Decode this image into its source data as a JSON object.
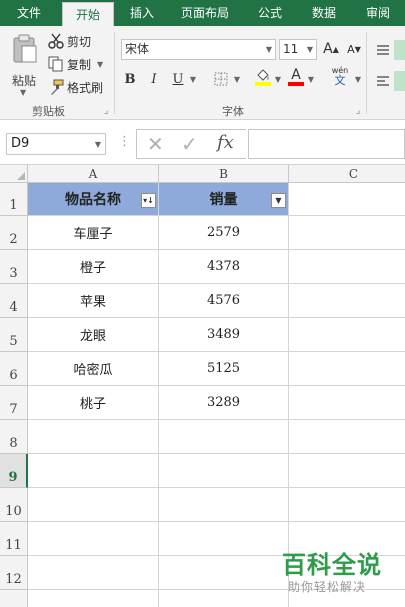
{
  "ribbon_tabs": [
    "文件",
    "开始",
    "插入",
    "页面布局",
    "公式",
    "数据",
    "审阅"
  ],
  "active_tab": "开始",
  "clipboard": {
    "paste_label": "粘贴",
    "cut_label": "剪切",
    "copy_label": "复制",
    "format_painter_label": "格式刷",
    "group_label": "剪贴板"
  },
  "font_group": {
    "font_name": "宋体",
    "font_size": "11",
    "bold": "B",
    "italic": "I",
    "underline": "U",
    "grow": "A",
    "shrink": "A",
    "font_color_glyph": "A",
    "phonetic_glyph": "wén",
    "phonetic_sub": "文",
    "group_label": "字体",
    "fill_color": "#ffff00",
    "font_color": "#ff0000"
  },
  "formula_bar": {
    "name_box": "D9",
    "fx_label": "fx",
    "value": ""
  },
  "columns": [
    "A",
    "B",
    "C"
  ],
  "row_numbers": [
    "1",
    "2",
    "3",
    "4",
    "5",
    "6",
    "7",
    "8",
    "9",
    "10",
    "11",
    "12"
  ],
  "selected_row": "9",
  "table": {
    "headers": [
      "物品名称",
      "销量"
    ],
    "rows": [
      [
        "车厘子",
        "2579"
      ],
      [
        "橙子",
        "4378"
      ],
      [
        "苹果",
        "4576"
      ],
      [
        "龙眼",
        "3489"
      ],
      [
        "哈密瓜",
        "5125"
      ],
      [
        "桃子",
        "3289"
      ]
    ]
  },
  "colors": {
    "accent": "#217346",
    "header_fill": "#8eaadb",
    "watermark": "#2e9c4a"
  },
  "watermark": {
    "title": "百科全说",
    "subtitle": "助你轻松解决"
  }
}
